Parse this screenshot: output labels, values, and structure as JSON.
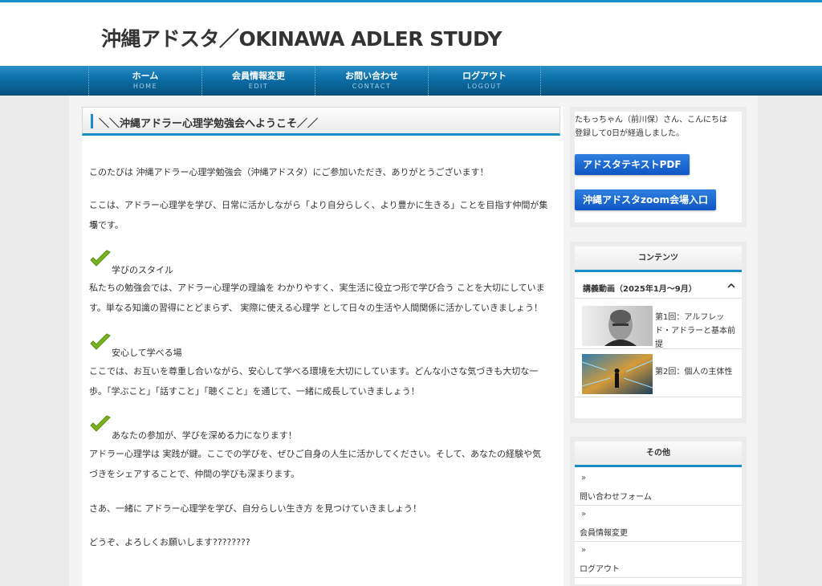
{
  "site": {
    "title": "沖縄アドスタ／OKINAWA ADLER STUDY"
  },
  "nav": [
    {
      "label": "ホーム",
      "sub": "HOME"
    },
    {
      "label": "会員情報変更",
      "sub": "EDIT"
    },
    {
      "label": "お問い合わせ",
      "sub": "CONTACT"
    },
    {
      "label": "ログアウト",
      "sub": "LOGOUT"
    }
  ],
  "main": {
    "heading": "＼＼沖縄アドラー心理学勉強会へようこそ／／",
    "intro1": "このたびは 沖縄アドラー心理学勉強会（沖縄アドスタ）にご参加いただき、ありがとうございます！",
    "intro2a": "ここは、アドラー心理学を学び、日常に活かしながら「より自分らしく、より豊かに生きる」ことを目指す仲間が集う",
    "intro2b": "場です。",
    "sections": [
      {
        "title": "学びのスタイル",
        "line1": "私たちの勉強会では、アドラー心理学の理論を わかりやすく、実生活に役立つ形で学び合う ことを大切にしていま",
        "line2": "す。単なる知識の習得にとどまらず、 実際に使える心理学 として日々の生活や人間関係に活かしていきましょう！"
      },
      {
        "title": "安心して学べる場",
        "line1": "ここでは、お互いを尊重し合いながら、安心して学べる環境を大切にしています。どんな小さな気づきも大切な一",
        "line2": "歩。「学ぶこと」「話すこと」「聴くこと」を通じて、一緒に成長していきましょう！"
      },
      {
        "title": "あなたの参加が、学びを深める力になります！",
        "line1": "アドラー心理学は 実践が鍵。ここでの学びを、ぜひご自身の人生に活かしてください。そして、あなたの経験や気",
        "line2": "づきをシェアすることで、仲間の学びも深まります。"
      }
    ],
    "closing1": "さあ、一緒に アドラー心理学を学び、自分らしい生き方 を見つけていきましょう！",
    "closing2": "どうぞ、よろしくお願いします????????"
  },
  "sidebar": {
    "greeting1": "たもっちゃん（前川保）さん、こんにちは",
    "greeting2": "登録して0日が経過しました。",
    "btn_pdf": "アドスタテキストPDF",
    "btn_zoom": "沖縄アドスタzoom会場入口",
    "contents_title": "コンテンツ",
    "accordion_label": "講義動画（2025年1月〜9月）",
    "videos": [
      {
        "title": "第1回：アルフレッド・アドラーと基本前提"
      },
      {
        "title": "第2回：個人の主体性"
      }
    ],
    "other_title": "その他",
    "links": [
      "問い合わせフォーム",
      "会員情報変更",
      "ログアウト"
    ],
    "link_arrow": "»"
  },
  "colors": {
    "accent": "#1a8cc8",
    "nav": "#0d6ea8",
    "button": "#1560d0",
    "check": "#7ab51d"
  }
}
